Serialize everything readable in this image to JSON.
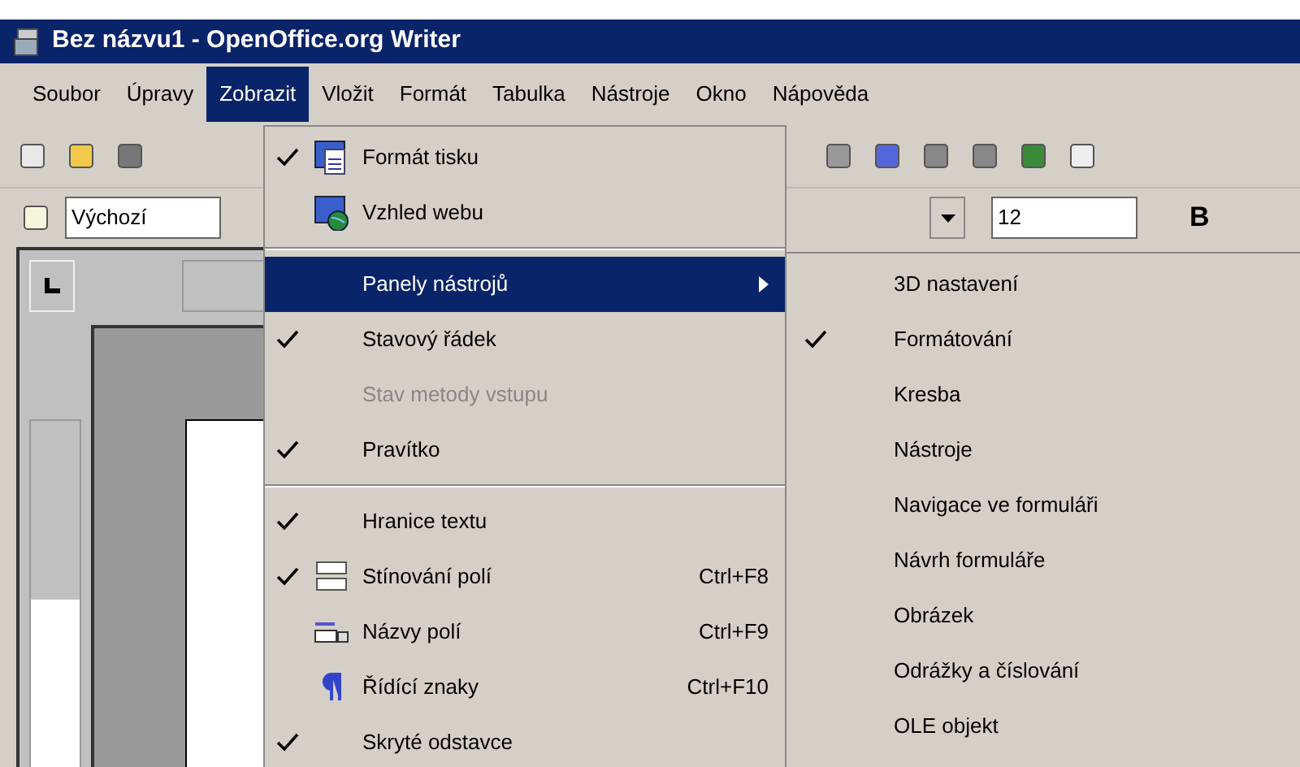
{
  "window": {
    "title": "Bez názvu1 - OpenOffice.org Writer"
  },
  "menu_bar": [
    {
      "label": "Soubor",
      "selected": false
    },
    {
      "label": "Úpravy",
      "selected": false
    },
    {
      "label": "Zobrazit",
      "selected": true
    },
    {
      "label": "Vložit",
      "selected": false
    },
    {
      "label": "Formát",
      "selected": false
    },
    {
      "label": "Tabulka",
      "selected": false
    },
    {
      "label": "Nástroje",
      "selected": false
    },
    {
      "label": "Okno",
      "selected": false
    },
    {
      "label": "Nápověda",
      "selected": false
    }
  ],
  "formatting_bar": {
    "style": "Výchozí",
    "font_size": "12",
    "bold": "B"
  },
  "view_menu": [
    {
      "kind": "item",
      "label": "Formát tisku",
      "checked": true,
      "disabled": false,
      "selected": false
    },
    {
      "kind": "item",
      "label": "Vzhled webu",
      "checked": false,
      "disabled": false,
      "selected": false
    },
    {
      "kind": "separator"
    },
    {
      "kind": "submenu",
      "label": "Panely nástrojů",
      "checked": false,
      "disabled": false,
      "selected": true
    },
    {
      "kind": "item",
      "label": "Stavový řádek",
      "checked": true,
      "disabled": false,
      "selected": false
    },
    {
      "kind": "item",
      "label": "Stav metody vstupu",
      "checked": false,
      "disabled": true,
      "selected": false
    },
    {
      "kind": "item",
      "label": "Pravítko",
      "checked": true,
      "disabled": false,
      "selected": false
    },
    {
      "kind": "separator"
    },
    {
      "kind": "item",
      "label": "Hranice textu",
      "checked": true,
      "disabled": false,
      "selected": false
    },
    {
      "kind": "item",
      "label": "Stínování polí",
      "checked": true,
      "disabled": false,
      "selected": false,
      "shortcut": "Ctrl+F8"
    },
    {
      "kind": "item",
      "label": "Názvy polí",
      "checked": false,
      "disabled": false,
      "selected": false,
      "shortcut": "Ctrl+F9"
    },
    {
      "kind": "item",
      "label": "Řídící znaky",
      "checked": false,
      "disabled": false,
      "selected": false,
      "shortcut": "Ctrl+F10"
    },
    {
      "kind": "item",
      "label": "Skryté odstavce",
      "checked": true,
      "disabled": false,
      "selected": false
    }
  ],
  "toolbars_submenu": [
    {
      "label": "3D nastavení",
      "checked": false
    },
    {
      "label": "Formátování",
      "checked": true
    },
    {
      "label": "Kresba",
      "checked": false
    },
    {
      "label": "Nástroje",
      "checked": false
    },
    {
      "label": "Navigace ve formuláři",
      "checked": false
    },
    {
      "label": "Návrh formuláře",
      "checked": false
    },
    {
      "label": "Obrázek",
      "checked": false
    },
    {
      "label": "Odrážky a číslování",
      "checked": false
    },
    {
      "label": "OLE objekt",
      "checked": false
    }
  ]
}
